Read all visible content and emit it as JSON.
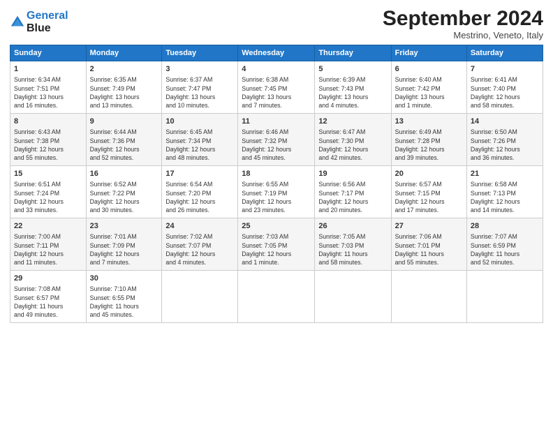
{
  "header": {
    "logo_line1": "General",
    "logo_line2": "Blue",
    "month": "September 2024",
    "location": "Mestrino, Veneto, Italy"
  },
  "weekdays": [
    "Sunday",
    "Monday",
    "Tuesday",
    "Wednesday",
    "Thursday",
    "Friday",
    "Saturday"
  ],
  "weeks": [
    [
      {
        "day": "1",
        "info": "Sunrise: 6:34 AM\nSunset: 7:51 PM\nDaylight: 13 hours\nand 16 minutes."
      },
      {
        "day": "2",
        "info": "Sunrise: 6:35 AM\nSunset: 7:49 PM\nDaylight: 13 hours\nand 13 minutes."
      },
      {
        "day": "3",
        "info": "Sunrise: 6:37 AM\nSunset: 7:47 PM\nDaylight: 13 hours\nand 10 minutes."
      },
      {
        "day": "4",
        "info": "Sunrise: 6:38 AM\nSunset: 7:45 PM\nDaylight: 13 hours\nand 7 minutes."
      },
      {
        "day": "5",
        "info": "Sunrise: 6:39 AM\nSunset: 7:43 PM\nDaylight: 13 hours\nand 4 minutes."
      },
      {
        "day": "6",
        "info": "Sunrise: 6:40 AM\nSunset: 7:42 PM\nDaylight: 13 hours\nand 1 minute."
      },
      {
        "day": "7",
        "info": "Sunrise: 6:41 AM\nSunset: 7:40 PM\nDaylight: 12 hours\nand 58 minutes."
      }
    ],
    [
      {
        "day": "8",
        "info": "Sunrise: 6:43 AM\nSunset: 7:38 PM\nDaylight: 12 hours\nand 55 minutes."
      },
      {
        "day": "9",
        "info": "Sunrise: 6:44 AM\nSunset: 7:36 PM\nDaylight: 12 hours\nand 52 minutes."
      },
      {
        "day": "10",
        "info": "Sunrise: 6:45 AM\nSunset: 7:34 PM\nDaylight: 12 hours\nand 48 minutes."
      },
      {
        "day": "11",
        "info": "Sunrise: 6:46 AM\nSunset: 7:32 PM\nDaylight: 12 hours\nand 45 minutes."
      },
      {
        "day": "12",
        "info": "Sunrise: 6:47 AM\nSunset: 7:30 PM\nDaylight: 12 hours\nand 42 minutes."
      },
      {
        "day": "13",
        "info": "Sunrise: 6:49 AM\nSunset: 7:28 PM\nDaylight: 12 hours\nand 39 minutes."
      },
      {
        "day": "14",
        "info": "Sunrise: 6:50 AM\nSunset: 7:26 PM\nDaylight: 12 hours\nand 36 minutes."
      }
    ],
    [
      {
        "day": "15",
        "info": "Sunrise: 6:51 AM\nSunset: 7:24 PM\nDaylight: 12 hours\nand 33 minutes."
      },
      {
        "day": "16",
        "info": "Sunrise: 6:52 AM\nSunset: 7:22 PM\nDaylight: 12 hours\nand 30 minutes."
      },
      {
        "day": "17",
        "info": "Sunrise: 6:54 AM\nSunset: 7:20 PM\nDaylight: 12 hours\nand 26 minutes."
      },
      {
        "day": "18",
        "info": "Sunrise: 6:55 AM\nSunset: 7:19 PM\nDaylight: 12 hours\nand 23 minutes."
      },
      {
        "day": "19",
        "info": "Sunrise: 6:56 AM\nSunset: 7:17 PM\nDaylight: 12 hours\nand 20 minutes."
      },
      {
        "day": "20",
        "info": "Sunrise: 6:57 AM\nSunset: 7:15 PM\nDaylight: 12 hours\nand 17 minutes."
      },
      {
        "day": "21",
        "info": "Sunrise: 6:58 AM\nSunset: 7:13 PM\nDaylight: 12 hours\nand 14 minutes."
      }
    ],
    [
      {
        "day": "22",
        "info": "Sunrise: 7:00 AM\nSunset: 7:11 PM\nDaylight: 12 hours\nand 11 minutes."
      },
      {
        "day": "23",
        "info": "Sunrise: 7:01 AM\nSunset: 7:09 PM\nDaylight: 12 hours\nand 7 minutes."
      },
      {
        "day": "24",
        "info": "Sunrise: 7:02 AM\nSunset: 7:07 PM\nDaylight: 12 hours\nand 4 minutes."
      },
      {
        "day": "25",
        "info": "Sunrise: 7:03 AM\nSunset: 7:05 PM\nDaylight: 12 hours\nand 1 minute."
      },
      {
        "day": "26",
        "info": "Sunrise: 7:05 AM\nSunset: 7:03 PM\nDaylight: 11 hours\nand 58 minutes."
      },
      {
        "day": "27",
        "info": "Sunrise: 7:06 AM\nSunset: 7:01 PM\nDaylight: 11 hours\nand 55 minutes."
      },
      {
        "day": "28",
        "info": "Sunrise: 7:07 AM\nSunset: 6:59 PM\nDaylight: 11 hours\nand 52 minutes."
      }
    ],
    [
      {
        "day": "29",
        "info": "Sunrise: 7:08 AM\nSunset: 6:57 PM\nDaylight: 11 hours\nand 49 minutes."
      },
      {
        "day": "30",
        "info": "Sunrise: 7:10 AM\nSunset: 6:55 PM\nDaylight: 11 hours\nand 45 minutes."
      },
      {
        "day": "",
        "info": ""
      },
      {
        "day": "",
        "info": ""
      },
      {
        "day": "",
        "info": ""
      },
      {
        "day": "",
        "info": ""
      },
      {
        "day": "",
        "info": ""
      }
    ]
  ]
}
